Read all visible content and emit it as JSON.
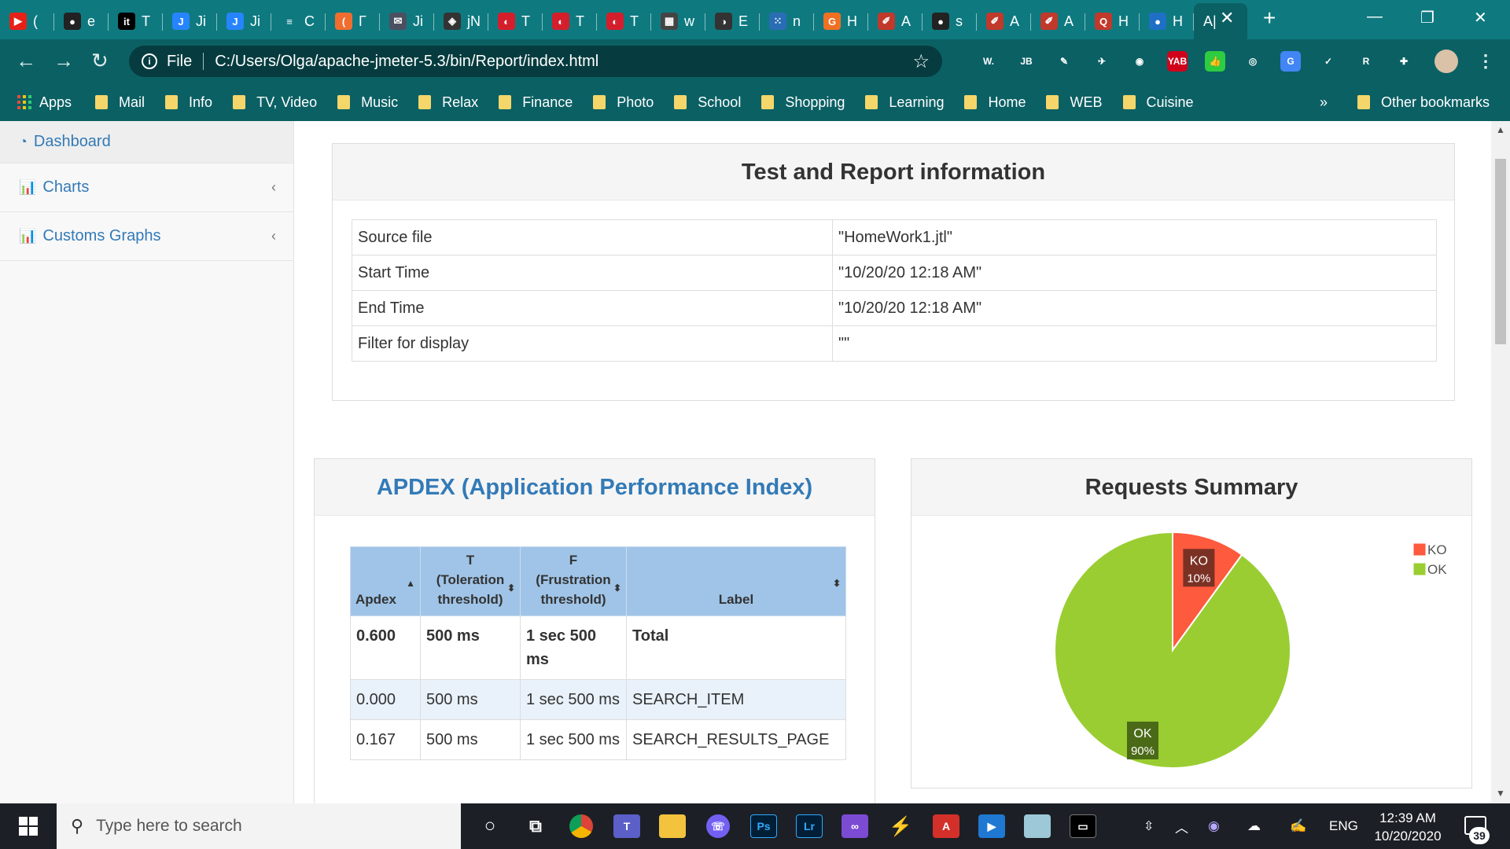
{
  "browser": {
    "tabs": [
      {
        "icon": "youtube-icon",
        "color": "#e62117",
        "glyph": "▶",
        "title": "("
      },
      {
        "icon": "github-icon",
        "color": "#222222",
        "glyph": "●",
        "title": "e"
      },
      {
        "icon": "itproger-icon",
        "color": "#000000",
        "glyph": "it",
        "title": "T"
      },
      {
        "icon": "jira-icon",
        "color": "#2684ff",
        "glyph": "J",
        "title": "Ji"
      },
      {
        "icon": "jira-icon",
        "color": "#2684ff",
        "glyph": "J",
        "title": "Ji"
      },
      {
        "icon": "code-icon",
        "color": "#0e7a80",
        "glyph": "≡",
        "title": "C"
      },
      {
        "icon": "orange-icon",
        "color": "#f06d2f",
        "glyph": "(",
        "title": "Г"
      },
      {
        "icon": "mail-icon",
        "color": "#4a5060",
        "glyph": "✉",
        "title": "Ji"
      },
      {
        "icon": "jmeter-icon",
        "color": "#333333",
        "glyph": "◈",
        "title": "jN"
      },
      {
        "icon": "opera-icon",
        "color": "#d41e2c",
        "glyph": "◐",
        "title": "T"
      },
      {
        "icon": "opera-icon",
        "color": "#d41e2c",
        "glyph": "◐",
        "title": "T"
      },
      {
        "icon": "opera-icon",
        "color": "#d41e2c",
        "glyph": "◐",
        "title": "T"
      },
      {
        "icon": "pattern-icon",
        "color": "#444444",
        "glyph": "▦",
        "title": "w"
      },
      {
        "icon": "compass-icon",
        "color": "#333333",
        "glyph": "◑",
        "title": "E"
      },
      {
        "icon": "dots-icon",
        "color": "#2a6db5",
        "glyph": "⁙",
        "title": "n"
      },
      {
        "icon": "orange-g-icon",
        "color": "#f07023",
        "glyph": "G",
        "title": "H"
      },
      {
        "icon": "feather-icon",
        "color": "#c0392b",
        "glyph": "✐",
        "title": "A"
      },
      {
        "icon": "github-icon",
        "color": "#222222",
        "glyph": "●",
        "title": "s"
      },
      {
        "icon": "feather-icon",
        "color": "#c0392b",
        "glyph": "✐",
        "title": "A"
      },
      {
        "icon": "feather-icon",
        "color": "#c0392b",
        "glyph": "✐",
        "title": "A"
      },
      {
        "icon": "q-icon",
        "color": "#c0392b",
        "glyph": "Q",
        "title": "H"
      },
      {
        "icon": "globe-icon",
        "color": "#1f6fc5",
        "glyph": "●",
        "title": "H"
      },
      {
        "icon": "active-tab-icon",
        "color": "#0b6064",
        "glyph": "",
        "title": "A|"
      }
    ],
    "new_tab_glyph": "+",
    "address": {
      "protocol_label": "File",
      "url": "C:/Users/Olga/apache-jmeter-5.3/bin/Report/index.html"
    },
    "extensions": [
      {
        "name": "wappalyzer-icon",
        "glyph": "W.",
        "color": "#0b6064"
      },
      {
        "name": "jetbrains-icon",
        "glyph": "JB",
        "color": "#0b6064"
      },
      {
        "name": "pen-icon",
        "glyph": "✎",
        "color": "#0b6064"
      },
      {
        "name": "plane-icon",
        "glyph": "✈",
        "color": "#0b6064"
      },
      {
        "name": "bulb-icon",
        "glyph": "◉",
        "color": "#0b6064"
      },
      {
        "name": "yab-icon",
        "glyph": "YAB",
        "color": "#d0021b"
      },
      {
        "name": "thumb-icon",
        "glyph": "👍",
        "color": "#2ecc40"
      },
      {
        "name": "lens-icon",
        "glyph": "◎",
        "color": "#0b6064"
      },
      {
        "name": "translate-icon",
        "glyph": "G",
        "color": "#4285f4"
      },
      {
        "name": "check-icon",
        "glyph": "✓",
        "color": "#0b6064"
      },
      {
        "name": "r-icon",
        "glyph": "R",
        "color": "#0b6064"
      },
      {
        "name": "puzzle-icon",
        "glyph": "✚",
        "color": "#0b6064"
      }
    ],
    "bookmarks": {
      "apps_label": "Apps",
      "folders": [
        "Mail",
        "Info",
        "TV, Video",
        "Music",
        "Relax",
        "Finance",
        "Photo",
        "School",
        "Shopping",
        "Learning",
        "Home",
        "WEB",
        "Cuisine"
      ],
      "overflow_label": "»",
      "other_label": "Other bookmarks"
    }
  },
  "sidebar": {
    "items": [
      {
        "label": "Dashboard",
        "icon": "dashboard-icon"
      },
      {
        "label": "Charts",
        "icon": "bar-chart-icon"
      },
      {
        "label": "Customs Graphs",
        "icon": "bar-chart-icon"
      }
    ]
  },
  "info_panel": {
    "title": "Test and Report information",
    "rows": [
      {
        "key": "Source file",
        "value": "\"HomeWork1.jtl\""
      },
      {
        "key": "Start Time",
        "value": "\"10/20/20 12:18 AM\""
      },
      {
        "key": "End Time",
        "value": "\"10/20/20 12:18 AM\""
      },
      {
        "key": "Filter for display",
        "value": "\"\""
      }
    ]
  },
  "apdex_panel": {
    "title": "APDEX (Application Performance Index)",
    "headers": {
      "apdex": "Apdex",
      "t_line1": "T",
      "t_line2": "(Toleration",
      "t_line3": "threshold)",
      "f_line1": "F",
      "f_line2": "(Frustration",
      "f_line3": "threshold)",
      "label": "Label"
    },
    "rows": [
      {
        "apdex": "0.600",
        "t": "500 ms",
        "f": "1 sec 500 ms",
        "label": "Total"
      },
      {
        "apdex": "0.000",
        "t": "500 ms",
        "f": "1 sec 500 ms",
        "label": "SEARCH_ITEM"
      },
      {
        "apdex": "0.167",
        "t": "500 ms",
        "f": "1 sec 500 ms",
        "label": "SEARCH_RESULTS_PAGE"
      }
    ]
  },
  "summary_panel": {
    "title": "Requests Summary"
  },
  "chart_data": {
    "type": "pie",
    "title": "Requests Summary",
    "categories": [
      "KO",
      "OK"
    ],
    "values": [
      10,
      90
    ],
    "data_labels": [
      "10%",
      "90%"
    ],
    "colors": [
      "#fd5a3e",
      "#9acd32"
    ],
    "legend": [
      "KO",
      "OK"
    ],
    "legend_position": "top-right"
  },
  "taskbar": {
    "search_placeholder": "Type here to search",
    "lang": "ENG",
    "time": "12:39 AM",
    "date": "10/20/2020",
    "notifications": "39"
  }
}
